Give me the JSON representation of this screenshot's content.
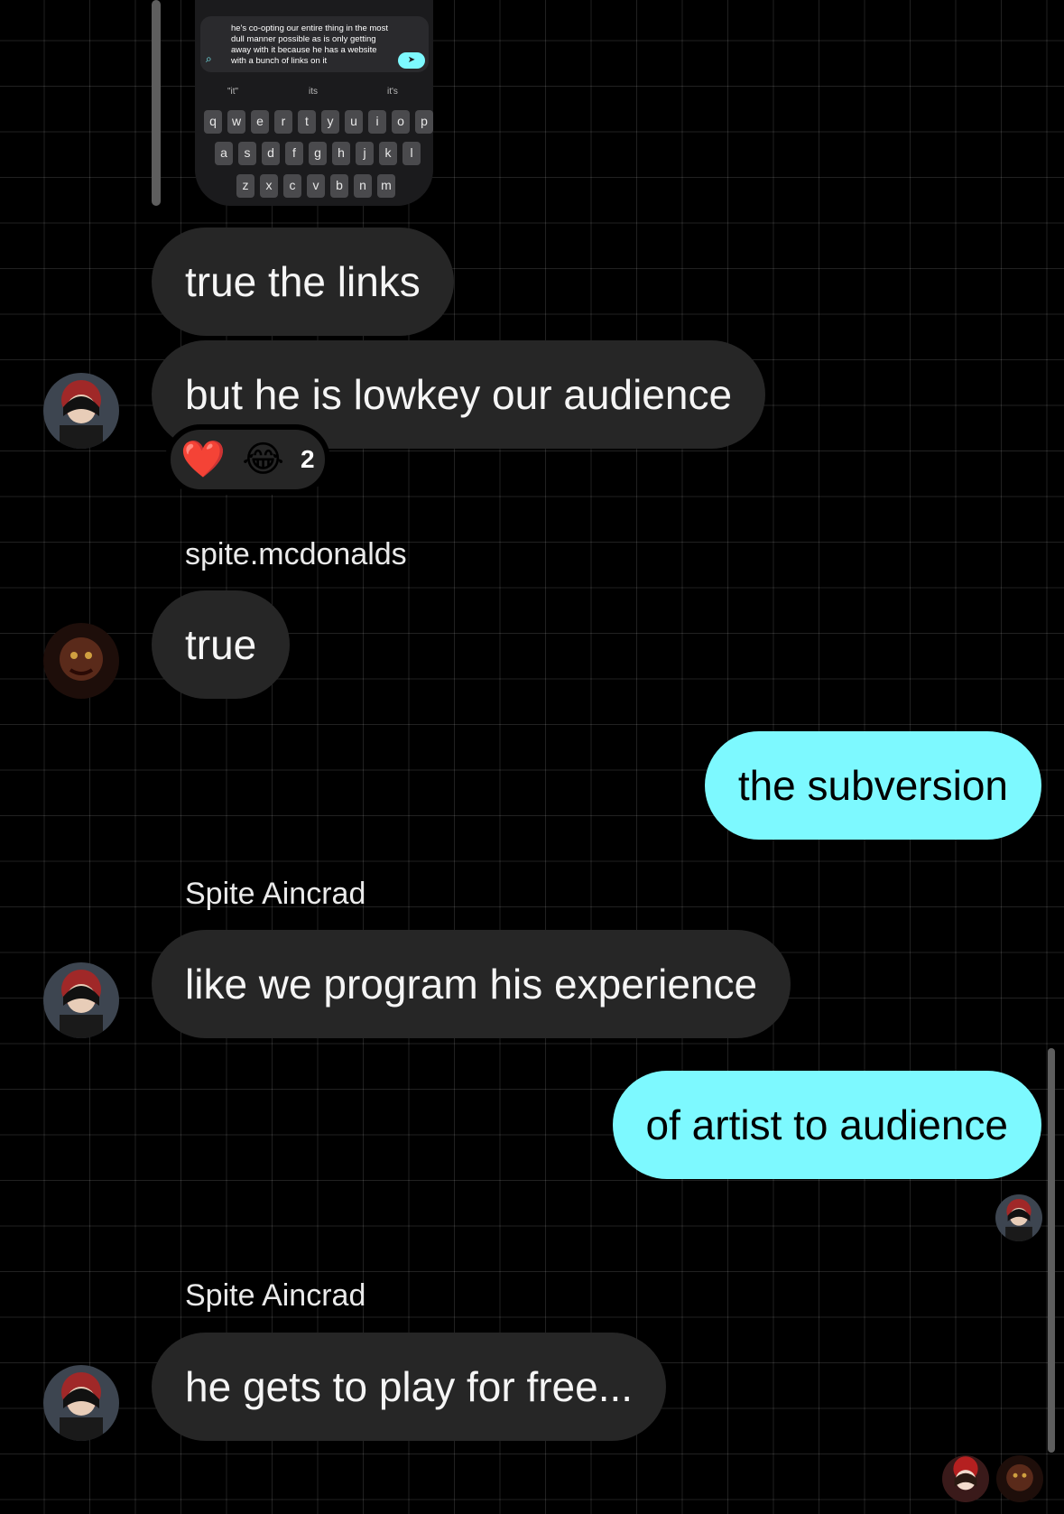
{
  "shared_screenshot": {
    "text": "he's co-opting our entire thing in the most dull manner possible as is only getting away with it because he has a website with a bunch of links on it",
    "suggestions": [
      "\"it\"",
      "its",
      "it's"
    ],
    "keyboard_rows": [
      [
        "q",
        "w",
        "e",
        "r",
        "t",
        "y",
        "u",
        "i",
        "o",
        "p"
      ],
      [
        "a",
        "s",
        "d",
        "f",
        "g",
        "h",
        "j",
        "k",
        "l"
      ],
      [
        "z",
        "x",
        "c",
        "v",
        "b",
        "n",
        "m"
      ]
    ]
  },
  "messages": [
    {
      "id": "m1",
      "text": "true the links",
      "direction": "incoming"
    },
    {
      "id": "m2",
      "text": "but he is lowkey our audience",
      "direction": "incoming"
    },
    {
      "id": "m3",
      "sender": "spite.mcdonalds",
      "text": "true",
      "direction": "incoming"
    },
    {
      "id": "m4",
      "text": "the subversion",
      "direction": "outgoing"
    },
    {
      "id": "m5",
      "sender": "Spite Aincrad",
      "text": "like we program his experience",
      "direction": "incoming"
    },
    {
      "id": "m6",
      "text": "of artist to audience",
      "direction": "outgoing"
    },
    {
      "id": "m7",
      "sender": "Spite Aincrad",
      "text": "he gets to play for free...",
      "direction": "incoming"
    }
  ],
  "reactions": {
    "emojis": [
      "❤️",
      "😂"
    ],
    "count": "2"
  },
  "colors": {
    "outgoing": "#7df9ff",
    "incoming": "#262626",
    "background": "#000000"
  }
}
